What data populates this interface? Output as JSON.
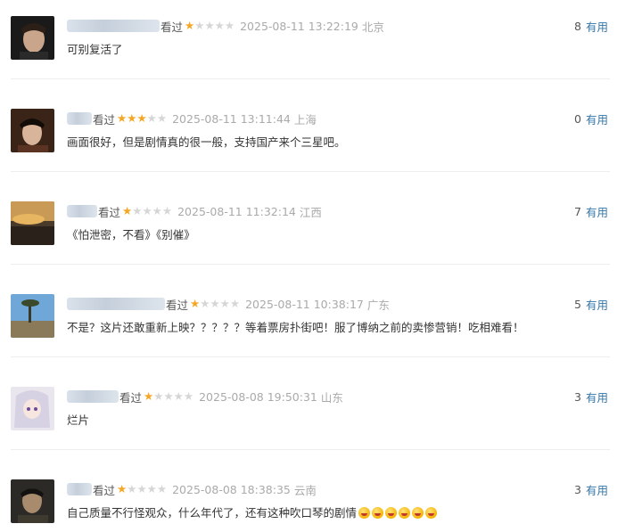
{
  "comments": [
    {
      "watched": "看过",
      "rating": 1,
      "time": "2025-08-11 13:22:19",
      "location": "北京",
      "text": "可别复活了",
      "useful_count": "8",
      "useful_label": "有用"
    },
    {
      "watched": "看过",
      "rating": 3,
      "time": "2025-08-11 13:11:44",
      "location": "上海",
      "text": "画面很好，但是剧情真的很一般，支持国产来个三星吧。",
      "useful_count": "0",
      "useful_label": "有用"
    },
    {
      "watched": "看过",
      "rating": 1,
      "time": "2025-08-11 11:32:14",
      "location": "江西",
      "text": "《怕泄密，不看》《别催》",
      "useful_count": "7",
      "useful_label": "有用"
    },
    {
      "watched": "看过",
      "rating": 1,
      "time": "2025-08-11 10:38:17",
      "location": "广东",
      "text": "不是？这片还敢重新上映？？？？？等着票房扑街吧！服了博纳之前的卖惨营销！吃相难看！",
      "useful_count": "5",
      "useful_label": "有用"
    },
    {
      "watched": "看过",
      "rating": 1,
      "time": "2025-08-08 19:50:31",
      "location": "山东",
      "text": "烂片",
      "useful_count": "3",
      "useful_label": "有用"
    },
    {
      "watched": "看过",
      "rating": 1,
      "time": "2025-08-08 18:38:35",
      "location": "云南",
      "text": "自己质量不行怪观众，什么年代了，还有这种吹口琴的剧情",
      "emoji_count": 6,
      "useful_count": "3",
      "useful_label": "有用"
    }
  ],
  "colors": {
    "star_on": "#f5a623",
    "star_off": "#d6d6d6",
    "useful_link": "#3377aa",
    "meta_text": "#aaaaaa"
  }
}
